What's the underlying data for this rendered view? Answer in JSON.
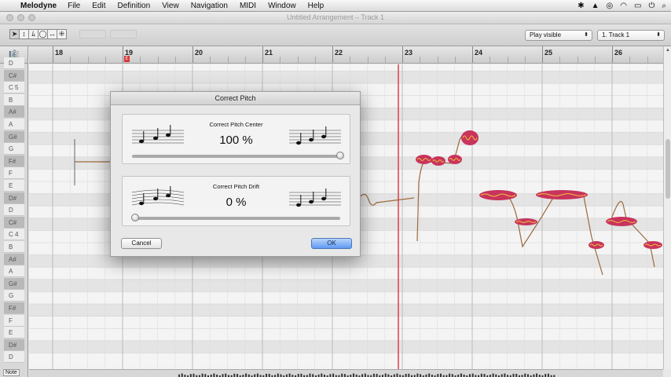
{
  "menubar": {
    "app_name": "Melodyne",
    "items": [
      "File",
      "Edit",
      "Definition",
      "View",
      "Navigation",
      "MIDI",
      "Window",
      "Help"
    ]
  },
  "window": {
    "title": "Untitled Arrangement – Track 1"
  },
  "toolbar": {
    "play_mode": "Play visible",
    "track": "1. Track 1"
  },
  "ruler": {
    "bars": [
      "18",
      "19",
      "20",
      "21",
      "22",
      "23",
      "24",
      "25",
      "26"
    ],
    "marker": "E"
  },
  "keyboard": {
    "notes": [
      "D",
      "C#",
      "C 5",
      "B",
      "A#",
      "A",
      "G#",
      "G",
      "F#",
      "F",
      "E",
      "D#",
      "D",
      "C#",
      "C 4",
      "B",
      "A#",
      "A",
      "G#",
      "G",
      "F#",
      "F",
      "E",
      "D#",
      "D"
    ],
    "note_mode": "Note"
  },
  "dialog": {
    "title": "Correct Pitch",
    "center": {
      "label": "Correct Pitch Center",
      "value": "100 %",
      "level": 1.0
    },
    "drift": {
      "label": "Correct Pitch Drift",
      "value": "0 %",
      "level": 0.0
    },
    "cancel": "Cancel",
    "ok": "OK"
  },
  "colors": {
    "blob": "#c8345c",
    "blob_inner": "#f2c23c",
    "pitch_line": "#9b6a3e",
    "playhead": "#d9343b"
  }
}
